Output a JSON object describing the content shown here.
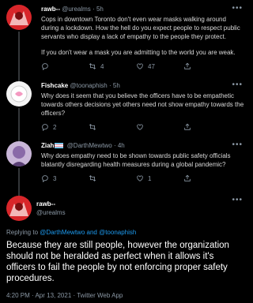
{
  "tweets": [
    {
      "name": "rawb--",
      "handle": "@urealms",
      "sep": "·",
      "time": "5h",
      "paragraphs": [
        "Cops in downtown Toronto don't even wear masks walking around during a lockdown.  How the hell do you expect people to respect public servants who display a lack of empathy to the people they protect.",
        "If you don't wear a mask you are admitting to the world you are weak."
      ],
      "replies": "",
      "retweets": "4",
      "likes": "47"
    },
    {
      "name": "Fishcake",
      "handle": "@toonaphish",
      "sep": "·",
      "time": "5h",
      "paragraphs": [
        "Why does it seem that you believe the officers have to be empathetic towards others decisions yet others need not show empathy towards the officers?"
      ],
      "replies": "2",
      "retweets": "",
      "likes": ""
    },
    {
      "name": "Ziah",
      "handle": "@DarthMewtwo",
      "sep": "·",
      "time": "4h",
      "paragraphs": [
        "Why does empathy need to be shown towards public safety officials blatantly disregarding health measures during a global pandemic?"
      ],
      "replies": "3",
      "retweets": "",
      "likes": "1"
    }
  ],
  "main": {
    "name": "rawb--",
    "handle": "@urealms",
    "replying_prefix": "Replying to ",
    "replying_user1": "@DarthMewtwo",
    "replying_and": " and ",
    "replying_user2": "@toonaphish",
    "text": "Because they are still people, however the organization should not be heralded as perfect when it allows it's officers to fail the people by not enforcing proper safety procedures.",
    "meta": "4:20 PM · Apr 13, 2021 · Twitter Web App"
  },
  "more_glyph": "•••",
  "colors": {
    "background": "#000000",
    "accent": "#1d9bf0",
    "muted": "#8b98a5"
  },
  "icons": [
    "reply-icon",
    "retweet-icon",
    "like-icon",
    "share-icon",
    "more-icon",
    "trans-flag-icon"
  ]
}
